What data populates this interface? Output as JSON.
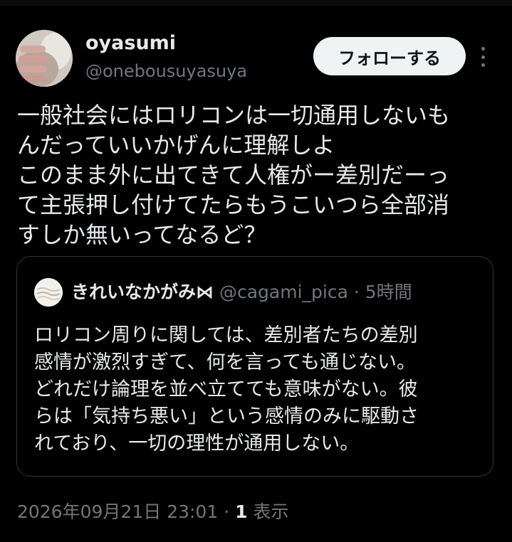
{
  "author": {
    "name": "oyasumi",
    "handle": "@onebousuyasuya",
    "follow_label": "フォローする"
  },
  "tweet": {
    "lines": [
      "一般社会にはロリコンは一切通用しないも",
      "んだっていいかげんに理解しよ",
      "このまま外に出てきて人権がー差別だーっ",
      "て主張押し付けてたらもうこいつら全部消",
      "すしか無いってなるど？"
    ]
  },
  "quote": {
    "name": "きれいなかがみ⋈",
    "handle": "@cagami_pica",
    "separator": "·",
    "time": "5時間",
    "lines": [
      "ロリコン周りに関しては、差別者たちの差別",
      "感情が激烈すぎて、何を言っても通じない。",
      "どれだけ論理を並べ立てても意味がない。彼",
      "らは「気持ち悪い」という感情のみに駆動さ",
      "れており、一切の理性が通用しない。"
    ]
  },
  "footer": {
    "timestamp": "2026年09月21日 23:01",
    "separator": "·",
    "views_count": "1",
    "views_label": "表示"
  },
  "icons": {
    "more": "more-vertical-icon"
  },
  "colors": {
    "background": "#000000",
    "text_primary": "#e7e9ea",
    "text_secondary": "#71767b",
    "follow_button_bg": "#eff3f4",
    "border": "#2f3336"
  }
}
